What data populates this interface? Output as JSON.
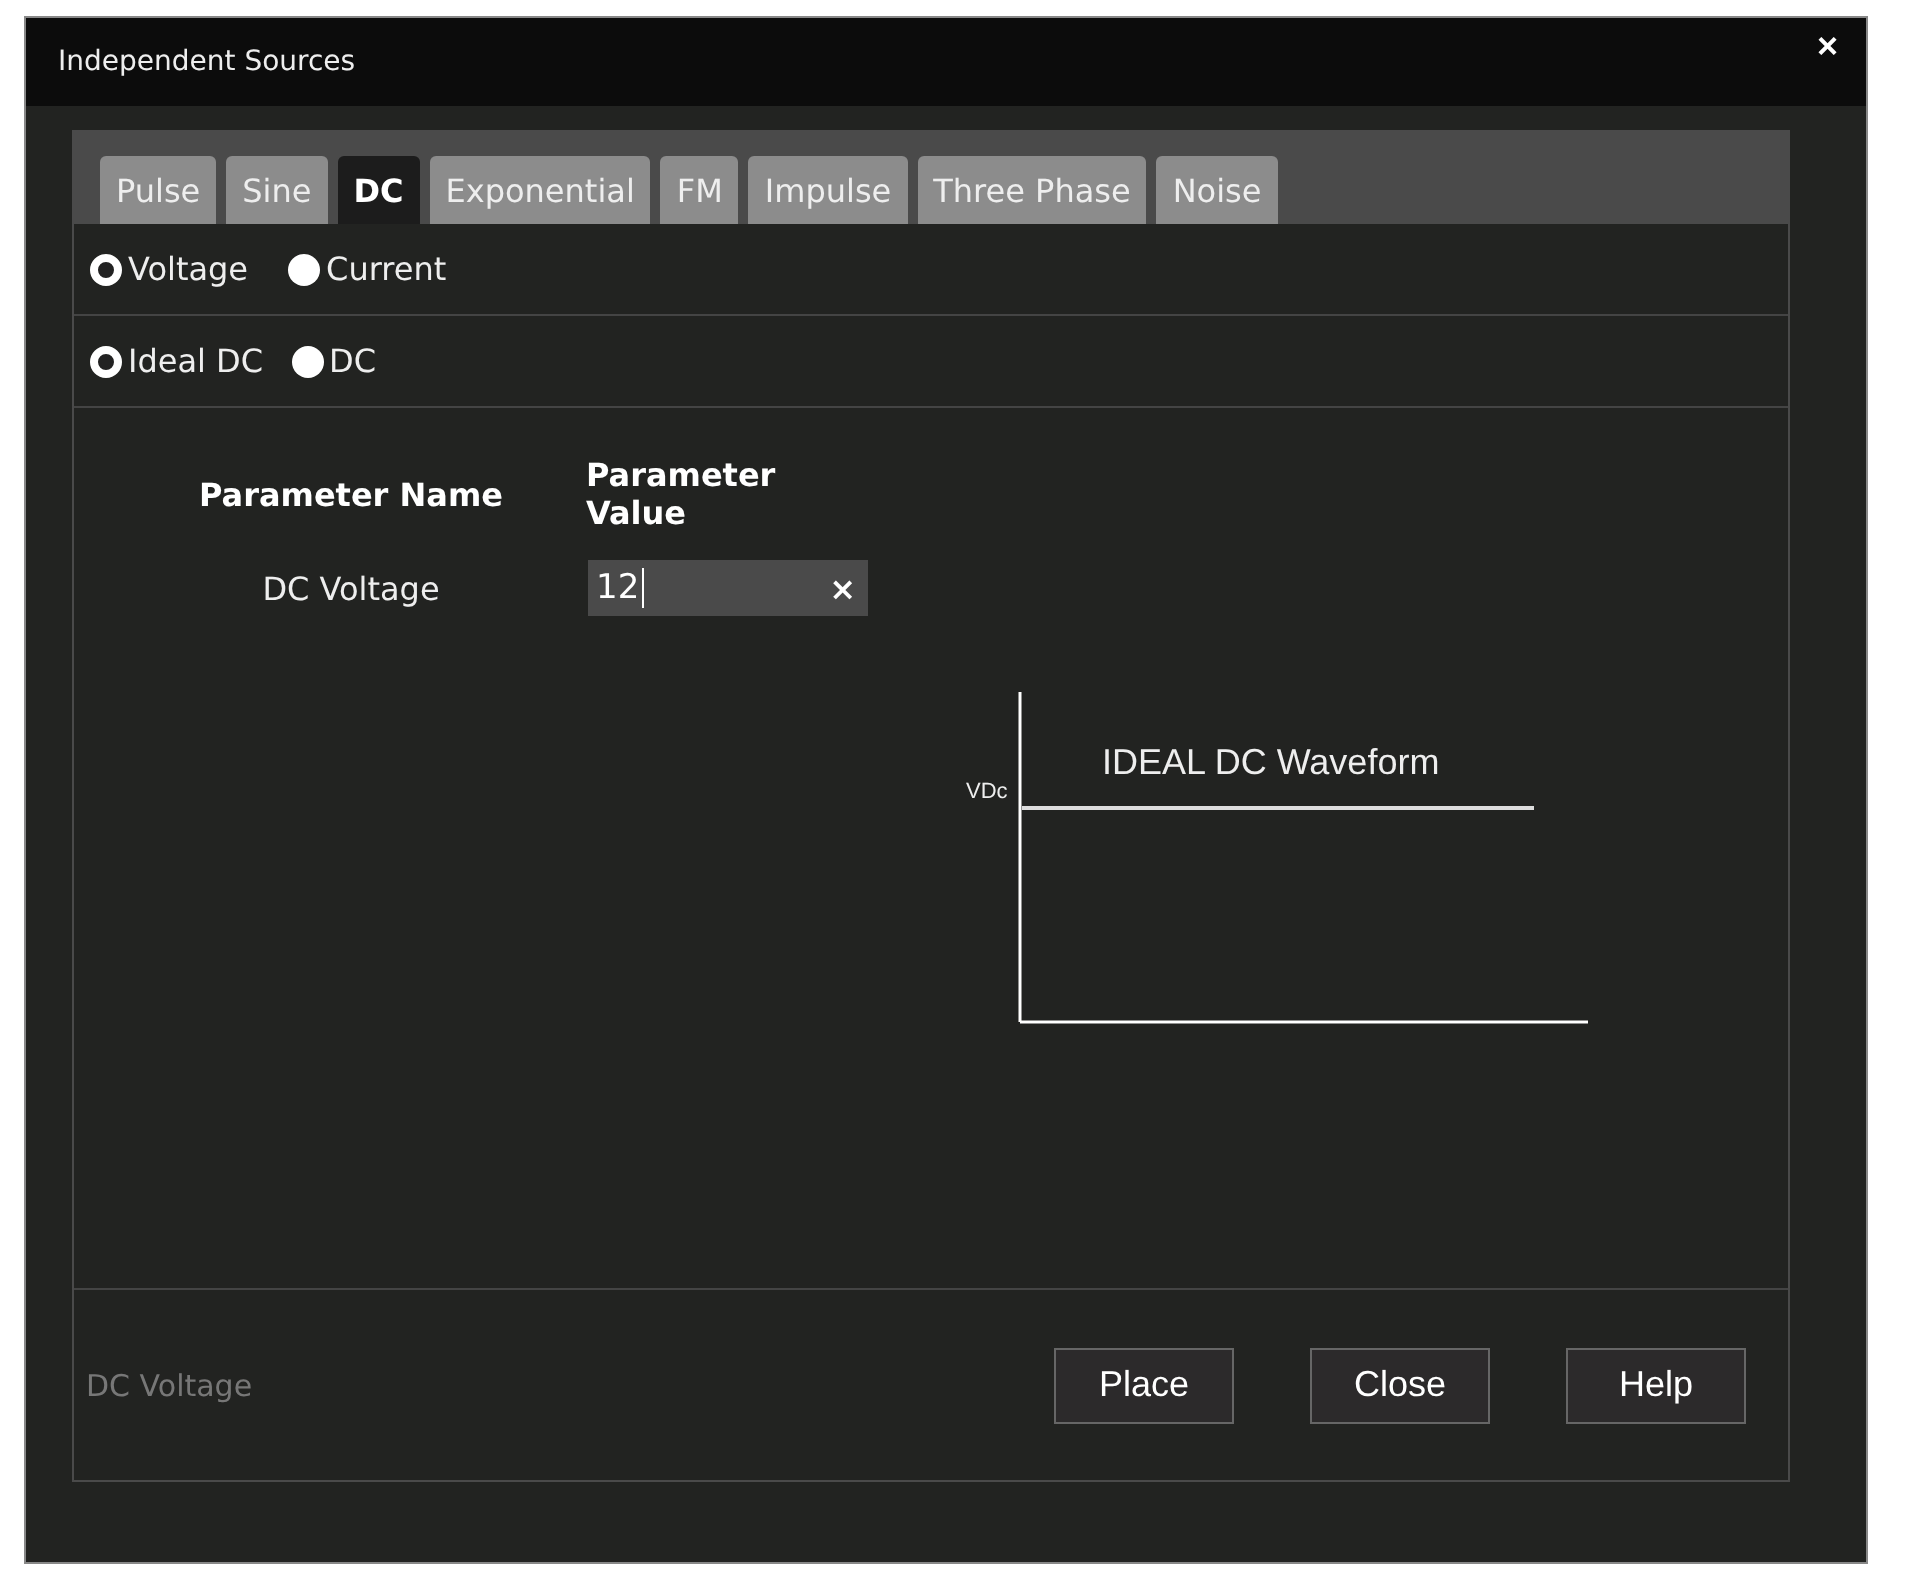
{
  "window": {
    "title": "Independent Sources",
    "close": "×"
  },
  "tabs": [
    {
      "label": "Pulse",
      "selected": false
    },
    {
      "label": "Sine",
      "selected": false
    },
    {
      "label": "DC",
      "selected": true
    },
    {
      "label": "Exponential",
      "selected": false
    },
    {
      "label": "FM",
      "selected": false
    },
    {
      "label": "Impulse",
      "selected": false
    },
    {
      "label": "Three Phase",
      "selected": false
    },
    {
      "label": "Noise",
      "selected": false
    }
  ],
  "source_type": [
    {
      "label": "Voltage",
      "selected": true
    },
    {
      "label": "Current",
      "selected": false
    }
  ],
  "model": [
    {
      "label": "Ideal DC",
      "selected": true
    },
    {
      "label": "DC",
      "selected": false
    }
  ],
  "parameters": {
    "columns": [
      "Parameter Name",
      "Parameter Value"
    ],
    "rows": [
      {
        "name": "DC Voltage",
        "value": "12",
        "clear": "×"
      }
    ]
  },
  "waveform": {
    "title": "IDEAL DC Waveform",
    "level_label": "VDc"
  },
  "status": "DC Voltage",
  "buttons": [
    "Place",
    "Close",
    "Help"
  ]
}
